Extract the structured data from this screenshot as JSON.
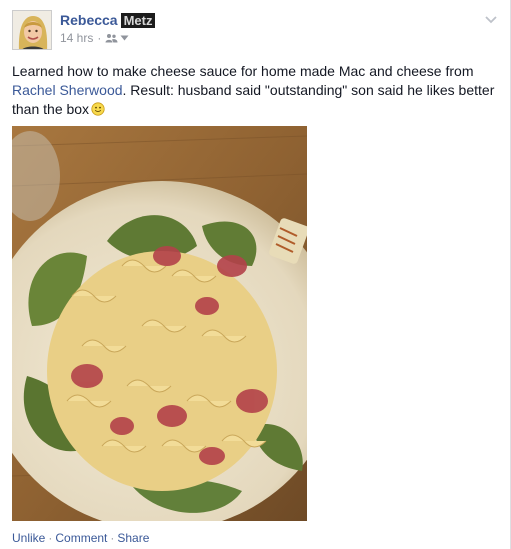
{
  "post": {
    "author_first": "Rebecca",
    "author_last": "Metz",
    "timestamp": "14 hrs",
    "audience_icon": "friends-icon",
    "text_before_link": "Learned how to make cheese sauce for home made Mac and cheese from ",
    "tagged_name": "Rachel Sherwood",
    "text_after_link": ". Result: husband said \"outstanding\" son said he likes better than the box",
    "emoji": "smiley-icon"
  },
  "actions": {
    "unlike": "Unlike",
    "comment": "Comment",
    "share": "Share",
    "separator": "·"
  },
  "colors": {
    "link": "#3b5998",
    "meta": "#90949c",
    "text": "#141823"
  }
}
